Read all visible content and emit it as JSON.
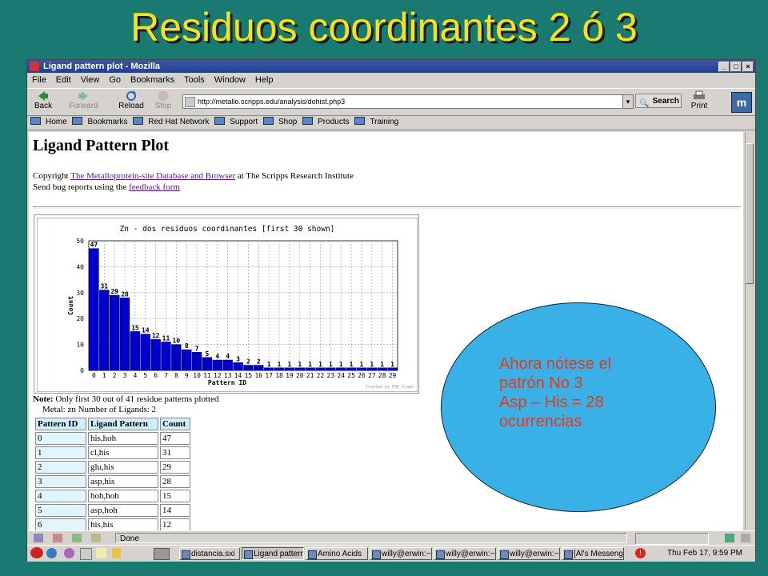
{
  "slide": {
    "title": "Residuos coordinantes  2  ó 3"
  },
  "window": {
    "title": "Ligand pattern plot - Mozilla"
  },
  "menu": [
    "File",
    "Edit",
    "View",
    "Go",
    "Bookmarks",
    "Tools",
    "Window",
    "Help"
  ],
  "nav": {
    "back": "Back",
    "forward": "Forward",
    "reload": "Reload",
    "stop": "Stop",
    "print": "Print",
    "search": "Search"
  },
  "url": "http://metallo.scripps.edu/analysis/dohist.php3",
  "personal_toolbar": [
    "Home",
    "Bookmarks",
    "Red Hat Network",
    "Support",
    "Shop",
    "Products",
    "Training"
  ],
  "page": {
    "heading": "Ligand Pattern Plot",
    "copyright_prefix": "Copyright ",
    "copyright_link": "The Metalloprotein-site Database and Browser",
    "copyright_suffix": " at The Scripps Research Institute",
    "bug_prefix": "Send bug reports using the ",
    "bug_link": "feedback form",
    "note_label": "Note:",
    "note_text": " Only first 30 out of 41 residue patterns plotted",
    "metal_line": "Metal: zn Number of Ligands: 2"
  },
  "table": {
    "headers": [
      "Pattern ID",
      "Ligand Pattern",
      "Count"
    ],
    "rows": [
      [
        "0",
        "his,hoh",
        "47"
      ],
      [
        "1",
        "cl,his",
        "31"
      ],
      [
        "2",
        "glu,his",
        "29"
      ],
      [
        "3",
        "asp,his",
        "28"
      ],
      [
        "4",
        "hoh,hoh",
        "15"
      ],
      [
        "5",
        "asp,hoh",
        "14"
      ],
      [
        "6",
        "his,his",
        "12"
      ]
    ]
  },
  "chart_data": {
    "type": "bar",
    "title": "Zn - dos residuos coordinantes [first 30 shown]",
    "xlabel": "Pattern ID",
    "ylabel": "Count",
    "ylim": [
      0,
      50
    ],
    "yticks": [
      0,
      10,
      20,
      30,
      40,
      50
    ],
    "categories": [
      "0",
      "1",
      "2",
      "3",
      "4",
      "5",
      "6",
      "7",
      "8",
      "9",
      "10",
      "11",
      "12",
      "13",
      "14",
      "15",
      "16",
      "17",
      "18",
      "19",
      "20",
      "21",
      "22",
      "23",
      "24",
      "25",
      "26",
      "27",
      "28",
      "29"
    ],
    "values": [
      47,
      31,
      29,
      28,
      15,
      14,
      12,
      11,
      10,
      8,
      7,
      5,
      4,
      4,
      3,
      2,
      2,
      1,
      1,
      1,
      1,
      1,
      1,
      1,
      1,
      1,
      1,
      1,
      1,
      1
    ],
    "grid": true,
    "watermark": "Created by PHP Graph",
    "bar_color": "#0000c8"
  },
  "status": {
    "text": "Done"
  },
  "taskbar": {
    "tasks": [
      "distancia.sxi",
      "Ligand pattern",
      "Amino Acids",
      "willy@erwin:~",
      "willy@erwin:~",
      "willy@erwin:~",
      "[Al's Messeng"
    ],
    "clock": "Thu Feb 17,  9:59 PM"
  },
  "callout": {
    "lines": [
      "Ahora nótese el",
      "patrón No 3",
      "Asp – His  =  28",
      "ocurrencias"
    ]
  }
}
